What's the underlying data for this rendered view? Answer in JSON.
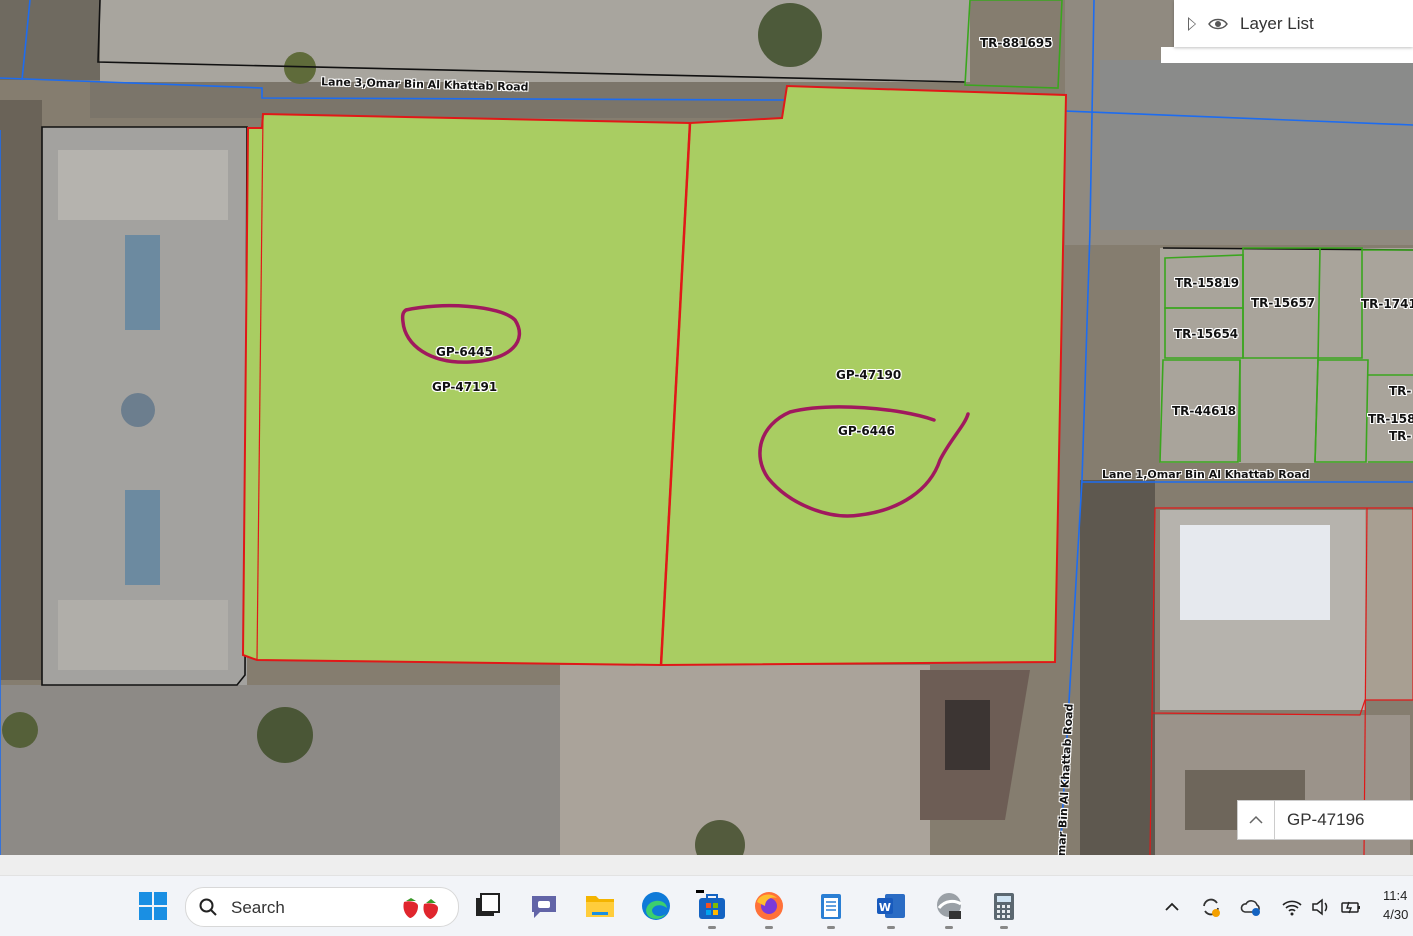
{
  "map": {
    "parcels": {
      "gp47191": "GP-47191",
      "gp47190": "GP-47190",
      "gp6445": "GP-6445",
      "gp6446": "GP-6446"
    },
    "tr_labels": {
      "tr881695": "TR-881695",
      "tr15819": "TR-15819",
      "tr15657": "TR-15657",
      "tr1741": "TR-1741",
      "tr15654": "TR-15654",
      "tr44618": "TR-44618",
      "tr_a": "TR-",
      "tr158": "TR-158",
      "tr_b": "TR-"
    },
    "roads": {
      "lane3": "Lane 3,Omar Bin Al Khattab Road",
      "lane1": "Lane 1,Omar Bin Al Khattab Road",
      "main": "Omar Bin Al Khattab Road"
    },
    "colors": {
      "parcel_fill": "#a9cd62",
      "parcel_border": "#e01818",
      "road_line": "#1d6cf0",
      "tr_border": "#3aa61e",
      "annotation": "#a0195e"
    }
  },
  "layer_list": {
    "label": "Layer List",
    "expand_icon": "caret-right-icon",
    "visibility_icon": "eye-icon"
  },
  "feature_selector": {
    "value": "GP-47196",
    "toggle_icon": "chevron-up-icon"
  },
  "taskbar": {
    "search_placeholder": "Search",
    "apps": [
      "windows-start",
      "search",
      "task-view",
      "teams-chat",
      "file-explorer",
      "edge",
      "microsoft-store",
      "firefox",
      "notepad",
      "word",
      "arcgis-pro",
      "calculator"
    ],
    "clock_time": "11:4",
    "clock_date": "4/30"
  }
}
